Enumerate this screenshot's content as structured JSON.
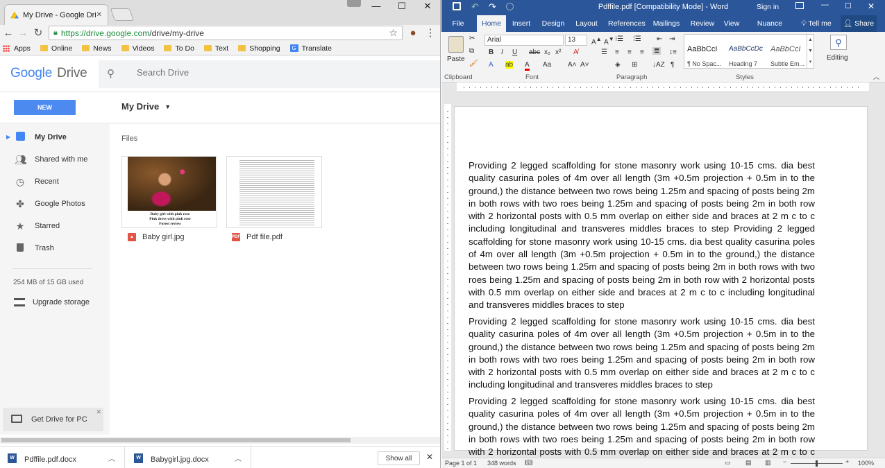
{
  "chrome": {
    "tab_title": "My Drive - Google Drive",
    "url_host": "https://drive.google.com",
    "url_path": "/drive/my-drive",
    "bookmarks": [
      "Apps",
      "Online",
      "News",
      "Videos",
      "To Do",
      "Text",
      "Shopping",
      "Translate"
    ]
  },
  "drive": {
    "logo_google": "Google",
    "logo_drive": "Drive",
    "search_placeholder": "Search Drive",
    "new_label": "NEW",
    "location_label": "My Drive",
    "sidebar": [
      {
        "label": "My Drive",
        "icon": "drive-icon"
      },
      {
        "label": "Shared with me",
        "icon": "people-icon"
      },
      {
        "label": "Recent",
        "icon": "clock-icon"
      },
      {
        "label": "Google Photos",
        "icon": "pinwheel-icon"
      },
      {
        "label": "Starred",
        "icon": "star-icon"
      },
      {
        "label": "Trash",
        "icon": "trash-icon"
      }
    ],
    "storage_text": "254 MB of 15 GB used",
    "upgrade_label": "Upgrade storage",
    "get_drive_label": "Get Drive for PC",
    "files_heading": "Files",
    "files": [
      {
        "name": "Baby girl.jpg",
        "type": "image",
        "caption": [
          "Baby girl with pink rose",
          "Pink dress with pink rose",
          "Forest review"
        ]
      },
      {
        "name": "Pdf file.pdf",
        "type": "pdf"
      }
    ],
    "downloads": [
      "Pdffile.pdf.docx",
      "Babygirl.jpg.docx"
    ],
    "show_all_label": "Show all"
  },
  "word": {
    "title": "Pdffile.pdf [Compatibility Mode] - Word",
    "signin": "Sign in",
    "tabs": [
      "File",
      "Home",
      "Insert",
      "Design",
      "Layout",
      "References",
      "Mailings",
      "Review",
      "View",
      "Nuance PDF",
      "Tell me",
      "Share"
    ],
    "active_tab": "Home",
    "font_name": "Arial",
    "font_size": "13",
    "groups": [
      "Clipboard",
      "Font",
      "Paragraph",
      "Styles",
      "Editing"
    ],
    "paste_label": "Paste",
    "editing_label": "Editing",
    "styles": [
      {
        "preview": "AaBbCcI",
        "name": "¶ No Spac..."
      },
      {
        "preview": "AaBbCcDc",
        "name": "Heading 7"
      },
      {
        "preview": "AaBbCcI",
        "name": "Subtle Em..."
      }
    ],
    "paragraph_long": "Providing 2 legged scaffolding for stone masonry work using 10-15 cms. dia best quality casurina poles of 4m over all length (3m +0.5m projection + 0.5m in to the ground,) the distance between two rows being 1.25m and spacing of posts being 2m in both rows with two roes being 1.25m and spacing of posts being 2m in both row with 2 horizontal posts with 0.5 mm overlap on either side and braces at 2 m c to c including longitudinal and transveres middles braces to step Providing 2 legged scaffolding for stone masonry work using 10-15 cms. dia best quality casurina poles of 4m over all length (3m +0.5m projection + 0.5m in to the ground,) the distance between two rows being 1.25m and spacing of posts being 2m in both rows with two roes being 1.25m and spacing of posts being 2m in both row with 2 horizontal posts with 0.5 mm overlap on either side and braces at 2 m c to c including longitudinal and transveres middles braces to step",
    "paragraph_short": "Providing 2 legged scaffolding for stone masonry work using 10-15 cms. dia best quality casurina poles of 4m over all length (3m +0.5m projection + 0.5m in to the ground,) the distance between two rows being 1.25m and spacing of posts being 2m in both rows with two roes being 1.25m and spacing of posts being 2m in both row with 2 horizontal posts with 0.5 mm overlap on either side and braces at 2 m c to c including longitudinal and transveres middles braces to step",
    "status_page": "Page 1 of 1",
    "status_words": "348 words",
    "zoom": "100%"
  }
}
